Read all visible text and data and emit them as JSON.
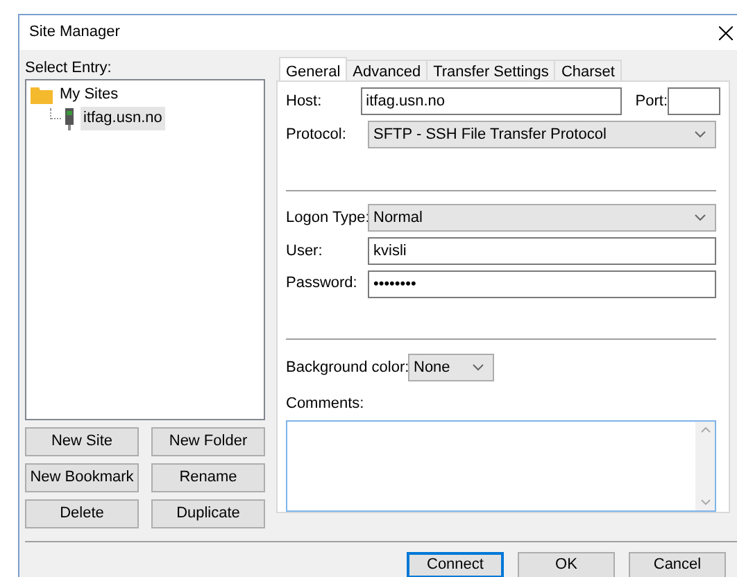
{
  "window": {
    "title": "Site Manager"
  },
  "select_entry": {
    "label": "Select Entry:",
    "tree": [
      {
        "label": "My Sites",
        "kind": "folder",
        "selected": false,
        "children": [
          {
            "label": "itfag.usn.no",
            "kind": "site",
            "selected": true
          }
        ]
      }
    ]
  },
  "site_buttons": [
    "New Site",
    "New Folder",
    "New Bookmark",
    "Rename",
    "Delete",
    "Duplicate"
  ],
  "tabs": [
    {
      "label": "General",
      "selected": true
    },
    {
      "label": "Advanced",
      "selected": false
    },
    {
      "label": "Transfer Settings",
      "selected": false
    },
    {
      "label": "Charset",
      "selected": false
    }
  ],
  "general": {
    "host": {
      "label": "Host:",
      "value": "itfag.usn.no"
    },
    "port": {
      "label": "Port:"
    },
    "protocol": {
      "label": "Protocol:",
      "value": "SFTP - SSH File Transfer Protocol"
    },
    "logon_type": {
      "label": "Logon Type:",
      "value": "Normal"
    },
    "user": {
      "label": "User:",
      "value": "kvisli"
    },
    "password": {
      "label": "Password:",
      "value": "••••••••"
    },
    "background_color": {
      "label": "Background color:",
      "value": "None"
    },
    "comments": {
      "label": "Comments:"
    }
  },
  "footer_buttons": [
    {
      "label": "Connect",
      "default": true
    },
    {
      "label": "OK",
      "default": false
    },
    {
      "label": "Cancel",
      "default": false
    }
  ]
}
